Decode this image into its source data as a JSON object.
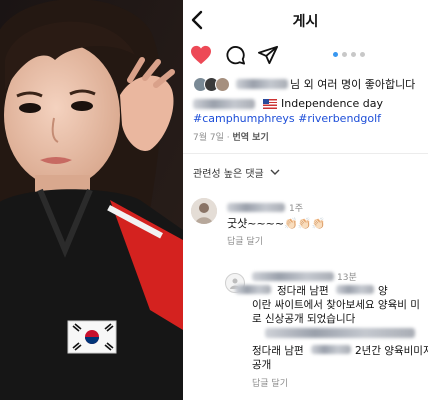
{
  "header": {
    "title": "게시"
  },
  "post": {
    "likes_text": "님 외 여러 명이 좋아합니다",
    "caption_text": "Independence day",
    "hashtags": "#camphumphreys #riverbendgolf",
    "date": "7월 7일",
    "translate": "번역 보기"
  },
  "comments": {
    "filter_label": "관련성 높은 댓글",
    "first": {
      "time": "1주",
      "text": "굿샷~~~~👏🏻👏🏻👏🏻",
      "reply": "답글 달기"
    },
    "second": {
      "time": "13분",
      "line1": "정다래 남편",
      "line1_tail": "양",
      "line2": "이란 싸이트에서 찾아보세요 양육비 미",
      "line3": "로 신상공개 되었습니다",
      "line4": "정다래 남편",
      "line4_tail": "2년간 양육비미지급",
      "line5": "공개",
      "reply": "답글 달기"
    }
  },
  "colors": {
    "like_red": "#ed4956",
    "link_blue": "#1d4ed8",
    "dot_active": "#3897f0",
    "muted": "#8e8e8e"
  },
  "icons": [
    "chevron-left-icon",
    "heart-icon",
    "comment-icon",
    "share-icon",
    "chevron-down-icon",
    "user-icon",
    "us-flag-icon"
  ]
}
